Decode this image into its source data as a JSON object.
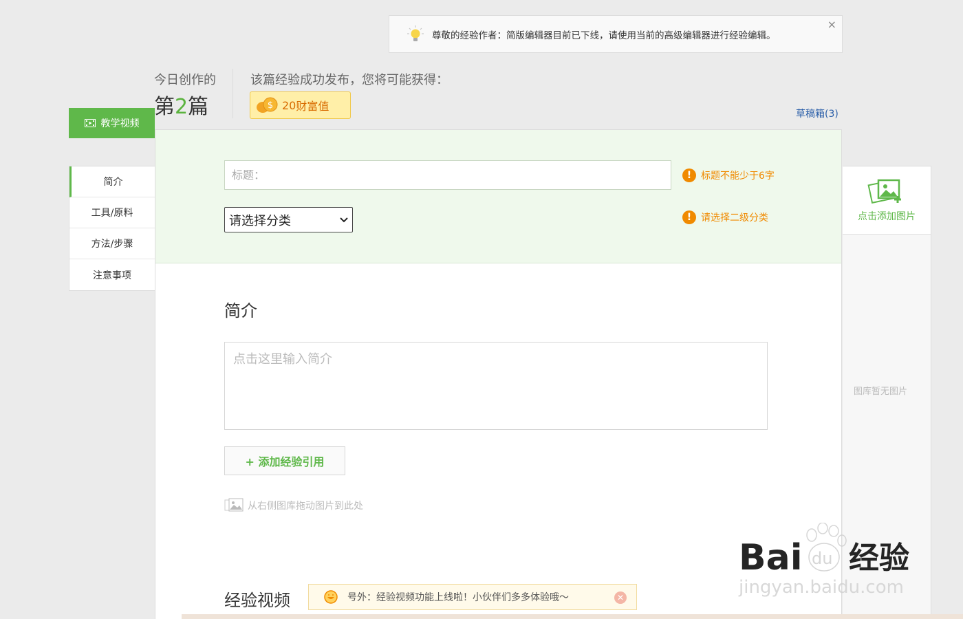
{
  "notice": {
    "text": "尊敬的经验作者：简版编辑器目前已下线，请使用当前的高级编辑器进行经验编辑。",
    "close": "×",
    "icon": "lightbulb-icon"
  },
  "today": {
    "label": "今日创作的",
    "prefix": "第",
    "count": "2",
    "suffix": "篇"
  },
  "reward": {
    "label": "该篇经验成功发布，您将可能获得：",
    "amount": "20",
    "unit": "财富值"
  },
  "drafts": {
    "label": "草稿箱",
    "count": "(3)"
  },
  "video_button": {
    "label": "教学视频",
    "icon": "film-icon"
  },
  "leftnav": {
    "items": [
      {
        "label": "简介"
      },
      {
        "label": "工具/原料"
      },
      {
        "label": "方法/步骤"
      },
      {
        "label": "注意事项"
      }
    ]
  },
  "form": {
    "title_placeholder": "标题：",
    "title_warning": "标题不能少于6字",
    "category_selected": "请选择分类",
    "category_warning": "请选择二级分类"
  },
  "intro": {
    "heading": "简介",
    "placeholder": "点击这里输入简介",
    "add_ref_button": "+ 添加经验引用",
    "drag_hint": "从右侧图库拖动图片到此处"
  },
  "video_section": {
    "heading": "经验视频",
    "tip": "号外：经验视频功能上线啦！小伙伴们多多体验哦～"
  },
  "image_panel": {
    "add_label": "点击添加图片",
    "empty_label": "图库暂无图片"
  },
  "watermark": {
    "brand": "Bai",
    "brand2": "du",
    "cn": "经验",
    "url": "jingyan.baidu.com"
  },
  "colors": {
    "accent": "#5fb84a",
    "warning": "#f08a00",
    "link": "#2a5ea8"
  }
}
